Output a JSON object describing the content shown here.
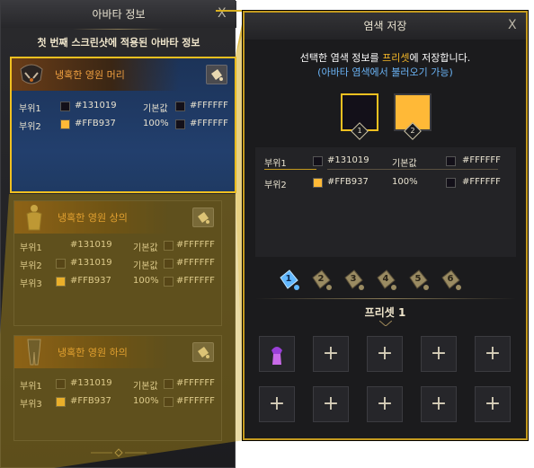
{
  "left_panel": {
    "title": "아바타 정보",
    "close_label": "X",
    "subtitle": "첫 번째 스크린샷에 적용된 아바타 정보",
    "items": [
      {
        "name": "냉혹한 영원 머리",
        "rows": [
          {
            "part": "부위1",
            "color_code": "#131019",
            "swatch": "#131019",
            "value": "기본값",
            "value_swatch": "#131019",
            "sub_code": "#FFFFFF"
          },
          {
            "part": "부위2",
            "color_code": "#FFB937",
            "swatch": "#FFB937",
            "value": "100%",
            "value_swatch": "#131019",
            "sub_code": "#FFFFFF"
          }
        ]
      },
      {
        "name": "냉혹한 영원 상의",
        "rows": [
          {
            "part": "부위1",
            "color_code": "#131019",
            "swatch": "#131019",
            "value": "기본값",
            "value_swatch": "#131019",
            "sub_code": "#FFFFFF"
          },
          {
            "part": "부위2",
            "color_code": "#131019",
            "swatch": "#131019",
            "value": "기본값",
            "value_swatch": "#131019",
            "sub_code": "#FFFFFF"
          },
          {
            "part": "부위3",
            "color_code": "#FFB937",
            "swatch": "#FFB937",
            "value": "100%",
            "value_swatch": "#131019",
            "sub_code": "#FFFFFF"
          }
        ]
      },
      {
        "name": "냉혹한 영원 하의",
        "rows": [
          {
            "part": "부위1",
            "color_code": "#131019",
            "swatch": "#131019",
            "value": "기본값",
            "value_swatch": "#131019",
            "sub_code": "#FFFFFF"
          },
          {
            "part": "부위3",
            "color_code": "#FFB937",
            "swatch": "#FFB937",
            "value": "100%",
            "value_swatch": "#131019",
            "sub_code": "#FFFFFF"
          }
        ]
      }
    ]
  },
  "right_panel": {
    "title": "염색 저장",
    "close_label": "X",
    "desc_prefix": "선택한 염색 정보를 ",
    "desc_highlight": "프리셋",
    "desc_suffix": "에 저장합니다.",
    "desc_note": "(아바타 염색에서 불러오기 가능)",
    "slots": [
      {
        "number": "1",
        "color": "#131019"
      },
      {
        "number": "2",
        "color": "#FFB937"
      }
    ],
    "rows": [
      {
        "part": "부위1",
        "color_code": "#131019",
        "value": "기본값",
        "sub_code": "#FFFFFF"
      },
      {
        "part": "부위2",
        "color_code": "#FFB937",
        "value": "100%",
        "sub_code": "#FFFFFF"
      }
    ],
    "preset_tabs": [
      "1",
      "2",
      "3",
      "4",
      "5",
      "6"
    ],
    "active_preset": "1",
    "preset_label": "프리셋 1",
    "grid_plus": "+"
  },
  "colors": {
    "accent_gold": "#c49a1e",
    "highlight_yellow": "#f0c020",
    "dye_dark": "#131019",
    "dye_gold": "#FFB937",
    "note_blue": "#6ab3f5",
    "item_name_orange": "#f0a040"
  }
}
